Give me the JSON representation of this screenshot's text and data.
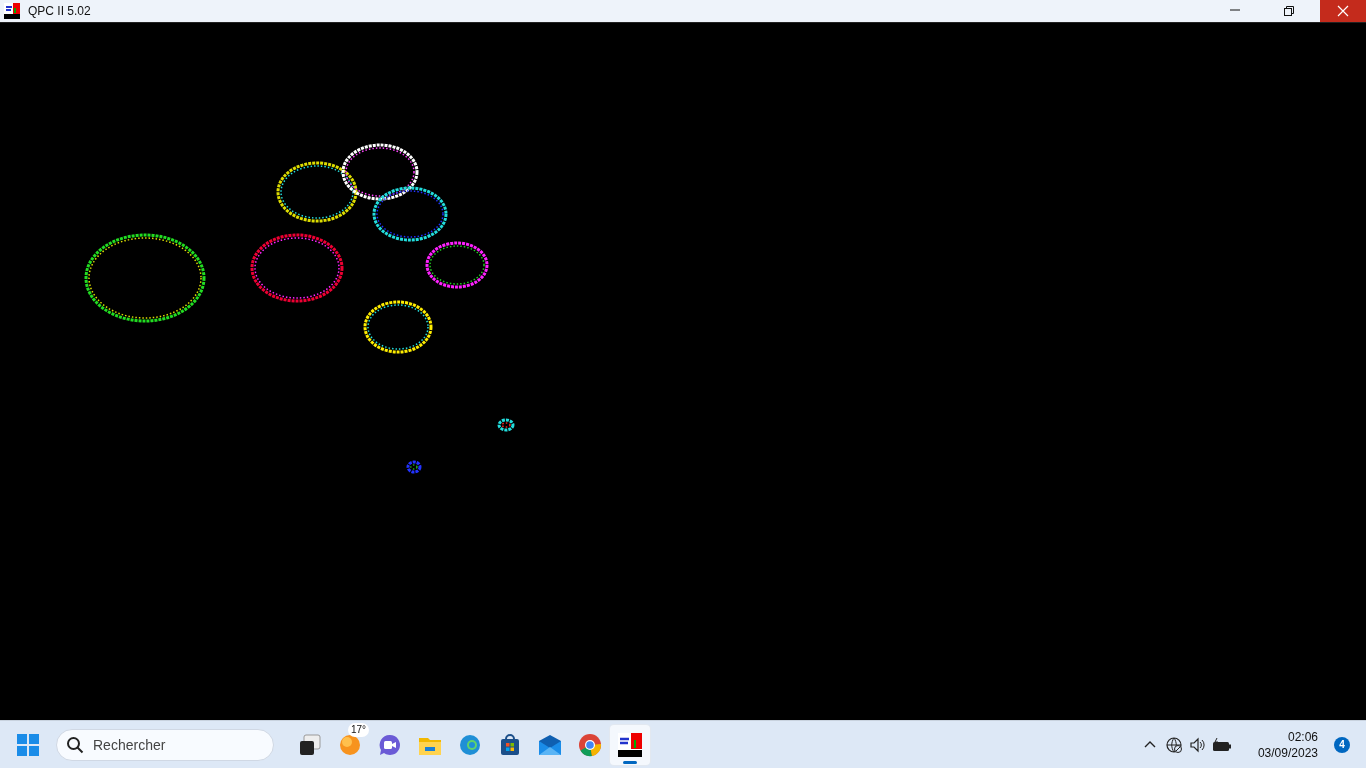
{
  "window": {
    "title": "QPC II 5.02",
    "controls": [
      {
        "kind": "minimize"
      },
      {
        "kind": "restore"
      },
      {
        "kind": "close"
      }
    ]
  },
  "taskbar": {
    "search": {
      "placeholder": "Rechercher"
    },
    "apps": [
      {
        "kind": "taskview",
        "selected": false
      },
      {
        "kind": "weather",
        "selected": false,
        "badge": "17°"
      },
      {
        "kind": "meet",
        "selected": false
      },
      {
        "kind": "explorer",
        "selected": false
      },
      {
        "kind": "edge",
        "selected": false
      },
      {
        "kind": "store",
        "selected": false
      },
      {
        "kind": "mail",
        "selected": false
      },
      {
        "kind": "chrome",
        "selected": false
      },
      {
        "kind": "qpc",
        "selected": true
      }
    ],
    "tray": [
      {
        "kind": "chevron"
      },
      {
        "kind": "network"
      },
      {
        "kind": "volume"
      },
      {
        "kind": "battery"
      }
    ],
    "clock": {
      "time": "02:06",
      "date": "03/09/2023"
    },
    "notifications": "4"
  }
}
